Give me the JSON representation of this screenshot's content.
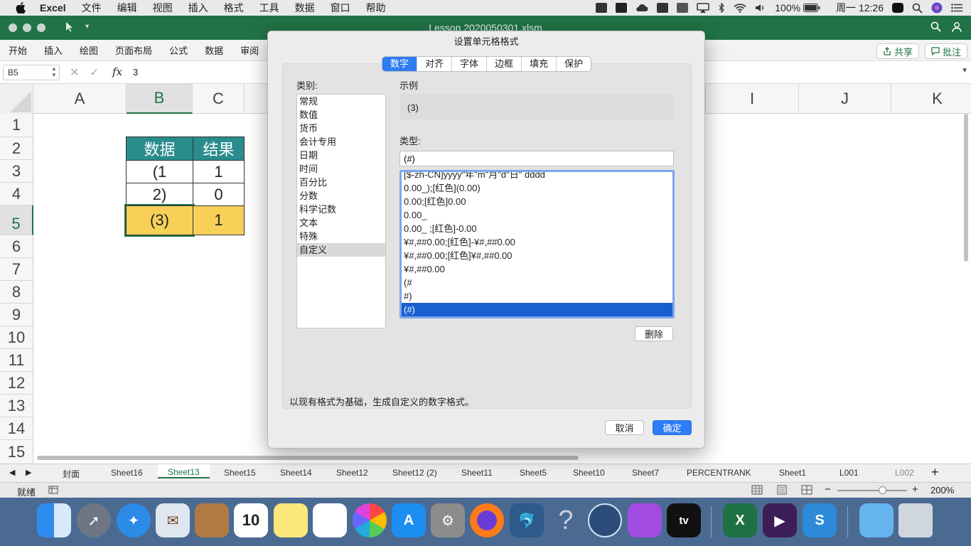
{
  "menubar": {
    "app": "Excel",
    "items": [
      "文件",
      "编辑",
      "视图",
      "插入",
      "格式",
      "工具",
      "数据",
      "窗口",
      "帮助"
    ],
    "battery": "100%",
    "clock": "周一 12:26"
  },
  "window": {
    "title": "Lesson 2020050301.xlsm"
  },
  "ribbon": {
    "tabs": [
      "开始",
      "插入",
      "绘图",
      "页面布局",
      "公式",
      "数据",
      "审阅"
    ],
    "share": "共享",
    "comments": "批注"
  },
  "formula_bar": {
    "name_box": "B5",
    "fx": "fx",
    "value": "3"
  },
  "grid": {
    "columns": [
      "A",
      "B",
      "C",
      "I",
      "J",
      "K"
    ],
    "rows": [
      "1",
      "2",
      "3",
      "4",
      "5",
      "6",
      "7",
      "8",
      "9",
      "10",
      "11",
      "12",
      "13",
      "14",
      "15"
    ],
    "table": {
      "header": [
        "数据",
        "结果"
      ],
      "rows": [
        [
          "(1",
          "1"
        ],
        [
          "2)",
          "0"
        ],
        [
          "(3)",
          "1"
        ]
      ]
    }
  },
  "sheets": [
    "封面",
    "Sheet16",
    "Sheet13",
    "Sheet15",
    "Sheet14",
    "Sheet12",
    "Sheet12 (2)",
    "Sheet11",
    "Sheet5",
    "Sheet10",
    "Sheet7",
    "PERCENTRANK",
    "Sheet1",
    "L001",
    "L002"
  ],
  "status": {
    "ready": "就绪",
    "zoom": "200%"
  },
  "dialog": {
    "title": "设置单元格格式",
    "tabs": [
      "数字",
      "对齐",
      "字体",
      "边框",
      "填充",
      "保护"
    ],
    "category_label": "类别:",
    "categories": [
      "常规",
      "数值",
      "货币",
      "会计专用",
      "日期",
      "时间",
      "百分比",
      "分数",
      "科学记数",
      "文本",
      "特殊",
      "自定义"
    ],
    "sample_label": "示例",
    "sample_value": "(3)",
    "type_label": "类型:",
    "type_value": "(#)",
    "formats": [
      "[$-zh-CN]yyyy\"年\"m\"月\"d\"日\" dddd",
      "0.00_);[红色](0.00)",
      "0.00;[红色]0.00",
      "0.00_",
      "0.00_ ;[红色]-0.00",
      "¥#,##0.00;[红色]-¥#,##0.00",
      "¥#,##0.00;[红色]¥#,##0.00",
      "¥#,##0.00",
      "(#",
      "#)",
      "(#)"
    ],
    "delete": "删除",
    "description": "以现有格式为基础，生成自定义的数字格式。",
    "cancel": "取消",
    "ok": "确定"
  }
}
